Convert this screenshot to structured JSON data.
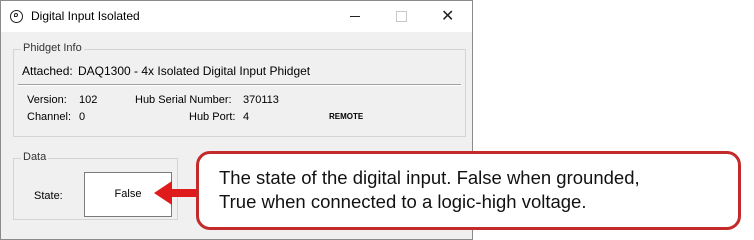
{
  "window": {
    "title": "Digital Input Isolated",
    "close_glyph": "✕"
  },
  "phidget_info": {
    "legend": "Phidget Info",
    "attached_label": "Attached:",
    "attached_value": "DAQ1300 - 4x Isolated Digital Input Phidget",
    "version_label": "Version:",
    "version_value": "102",
    "hub_serial_label": "Hub Serial Number:",
    "hub_serial_value": "370113",
    "channel_label": "Channel:",
    "channel_value": "0",
    "hub_port_label": "Hub Port:",
    "hub_port_value": "4",
    "remote_label": "REMOTE"
  },
  "data": {
    "legend": "Data",
    "state_label": "State:",
    "state_value": "False"
  },
  "callout": {
    "line1": "The state of the digital input. False when grounded,",
    "line2": "True when connected to a logic-high voltage."
  },
  "colors": {
    "callout_border": "#c42a2a",
    "arrow": "#e01b1b"
  }
}
